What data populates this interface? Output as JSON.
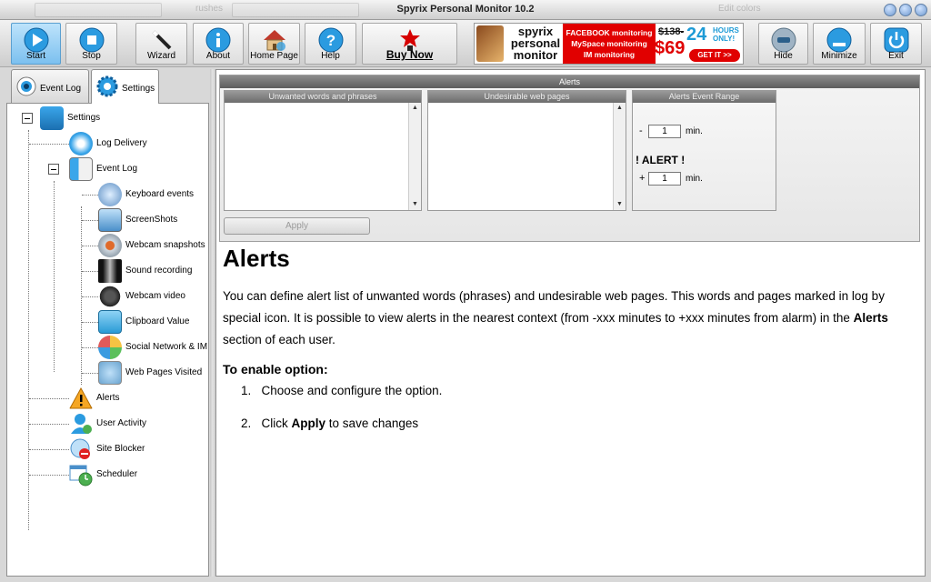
{
  "window": {
    "title": "Spyrix Personal Monitor 10.2",
    "background_fragments": [
      "rushes",
      "Edit colors"
    ]
  },
  "toolbar": {
    "start": "Start",
    "stop": "Stop",
    "wizard": "Wizard",
    "about": "About",
    "home_page": "Home Page",
    "help": "Help",
    "buy_now": "Buy Now",
    "hide": "Hide",
    "minimize": "Minimize",
    "exit": "Exit"
  },
  "ad": {
    "brand_line1": "spyrix",
    "brand_line2": "personal",
    "brand_line3": "monitor",
    "line1": "FACEBOOK monitoring",
    "line2": "MySpace monitoring",
    "line3": "IM monitoring",
    "old_price": "$138-",
    "price": "$69",
    "hours": "24",
    "hours_text": "HOURS ONLY!",
    "cta": "GET IT >>"
  },
  "tabs": {
    "event_log": "Event Log",
    "settings": "Settings"
  },
  "tree": {
    "settings": "Settings",
    "log_delivery": "Log Delivery",
    "event_log": "Event Log",
    "keyboard_events": "Keyboard events",
    "screenshots": "ScreenShots",
    "webcam_snapshots": "Webcam snapshots",
    "sound_recording": "Sound recording",
    "webcam_video": "Webcam video",
    "clipboard_value": "Clipboard Value",
    "social_network": "Social Network & IM",
    "web_pages_visited": "Web Pages Visited",
    "alerts": "Alerts",
    "user_activity": "User Activity",
    "site_blocker": "Site Blocker",
    "scheduler": "Scheduler"
  },
  "alerts_panel": {
    "header": "Alerts",
    "unwanted_words_label": "Unwanted words and phrases",
    "undesirable_pages_label": "Undesirable web pages",
    "event_range_label": "Alerts Event Range",
    "minus_sign": "-",
    "plus_sign": "+",
    "minus_value": "1",
    "plus_value": "1",
    "unit": "min.",
    "alert_text": "! ALERT !",
    "apply": "Apply"
  },
  "help": {
    "title": "Alerts",
    "body_part1": "You can define alert list of unwanted words (phrases) and undesirable web pages. This words and pages marked in log by special icon. It is possible to view alerts in the nearest context (from -xxx minutes to +xxx minutes from alarm) in the ",
    "body_bold": "Alerts",
    "body_part2": " section of each user.",
    "subtitle": "To enable option:",
    "step1_num": "1.",
    "step1": "Choose and configure the option.",
    "step2_num": "2.",
    "step2_pre": "Click ",
    "step2_bold": "Apply",
    "step2_post": " to save changes"
  }
}
